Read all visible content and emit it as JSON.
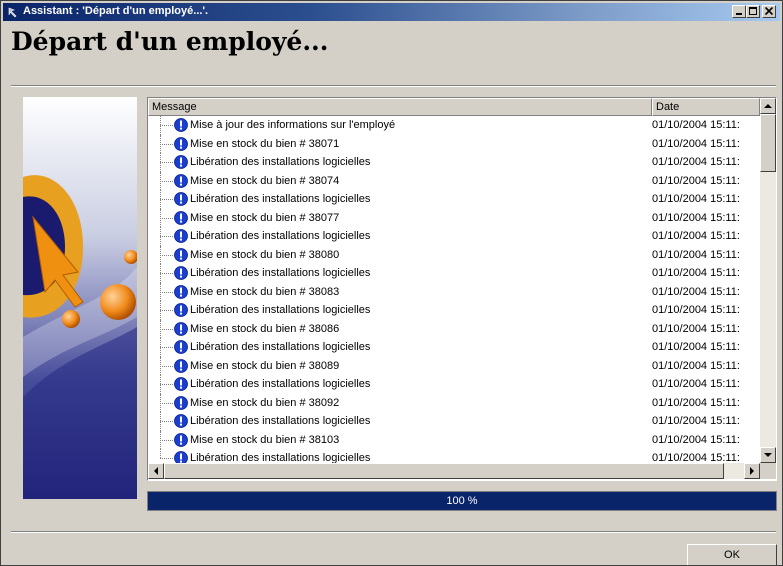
{
  "window": {
    "title": "Assistant : 'Départ d'un employé...'.",
    "heading": "Départ d'un employé..."
  },
  "list": {
    "columns": [
      "Message",
      "Date"
    ],
    "rows": [
      {
        "message": "Mise à jour des informations sur l'employé",
        "date": "01/10/2004 15:11:"
      },
      {
        "message": "Mise en stock du bien # 38071",
        "date": "01/10/2004 15:11:"
      },
      {
        "message": "Libération des installations logicielles",
        "date": "01/10/2004 15:11:"
      },
      {
        "message": "Mise en stock du bien # 38074",
        "date": "01/10/2004 15:11:"
      },
      {
        "message": "Libération des installations logicielles",
        "date": "01/10/2004 15:11:"
      },
      {
        "message": "Mise en stock du bien # 38077",
        "date": "01/10/2004 15:11:"
      },
      {
        "message": "Libération des installations logicielles",
        "date": "01/10/2004 15:11:"
      },
      {
        "message": "Mise en stock du bien # 38080",
        "date": "01/10/2004 15:11:"
      },
      {
        "message": "Libération des installations logicielles",
        "date": "01/10/2004 15:11:"
      },
      {
        "message": "Mise en stock du bien # 38083",
        "date": "01/10/2004 15:11:"
      },
      {
        "message": "Libération des installations logicielles",
        "date": "01/10/2004 15:11:"
      },
      {
        "message": "Mise en stock du bien # 38086",
        "date": "01/10/2004 15:11:"
      },
      {
        "message": "Libération des installations logicielles",
        "date": "01/10/2004 15:11:"
      },
      {
        "message": "Mise en stock du bien # 38089",
        "date": "01/10/2004 15:11:"
      },
      {
        "message": "Libération des installations logicielles",
        "date": "01/10/2004 15:11:"
      },
      {
        "message": "Mise en stock du bien # 38092",
        "date": "01/10/2004 15:11:"
      },
      {
        "message": "Libération des installations logicielles",
        "date": "01/10/2004 15:11:"
      },
      {
        "message": "Mise en stock du bien # 38103",
        "date": "01/10/2004 15:11:"
      },
      {
        "message": "Libération des installations logicielles",
        "date": "01/10/2004 15:11:"
      }
    ]
  },
  "progress": {
    "label": "100 %",
    "value": 1.0
  },
  "buttons": {
    "ok": "OK"
  },
  "icons": {
    "row_icon": "info-exclamation-icon",
    "app_icon": "app-icon"
  },
  "colors": {
    "titlebar_start": "#0a246a",
    "titlebar_end": "#a6caf0",
    "progress_fill": "#0a246a",
    "dialog_bg": "#d4d0c8"
  }
}
